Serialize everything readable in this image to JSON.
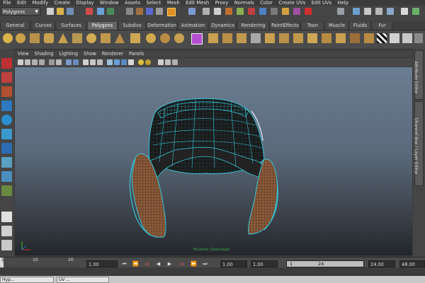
{
  "menubar": [
    "File",
    "Edit",
    "Modify",
    "Create",
    "Display",
    "Window",
    "Assets",
    "Select",
    "Mesh",
    "Edit Mesh",
    "Proxy",
    "Normals",
    "Color",
    "Create UVs",
    "Edit UVs",
    "Help"
  ],
  "status": {
    "mode": "Polygons"
  },
  "shelf_tabs": [
    "General",
    "Curves",
    "Surfaces",
    "Polygons",
    "Subdivs",
    "Deformation",
    "Animation",
    "Dynamics",
    "Rendering",
    "PaintEffects",
    "Toon",
    "Muscle",
    "Fluids",
    "Fur"
  ],
  "active_shelf_tab": "Polygons",
  "viewport_menu": [
    "View",
    "Shading",
    "Lighting",
    "Show",
    "Renderer",
    "Panels"
  ],
  "viewport_overlay_text": "Mudbox Opencage",
  "right_tabs": [
    "Attribute Editor",
    "Channel Box / Layer Editor"
  ],
  "timeline": {
    "ticks": [
      "1",
      "10",
      "20"
    ]
  },
  "range": {
    "current_frame": "1.00",
    "start": "1.00",
    "end": "1.00",
    "slider_left": "1",
    "slider_right": "24",
    "range_end": "24.00",
    "max_end": "48.00"
  },
  "playback_buttons": [
    "⏮",
    "⏪",
    "◂|",
    "◀",
    "▶",
    "|▸",
    "⏩",
    "⏭"
  ],
  "taskbar": [
    "Hyp...",
    "UV ..."
  ],
  "colors": {
    "wire": "#38c4d8",
    "mesh_fill": "#8a5a3a",
    "viewport_top": "#6b7d92"
  }
}
